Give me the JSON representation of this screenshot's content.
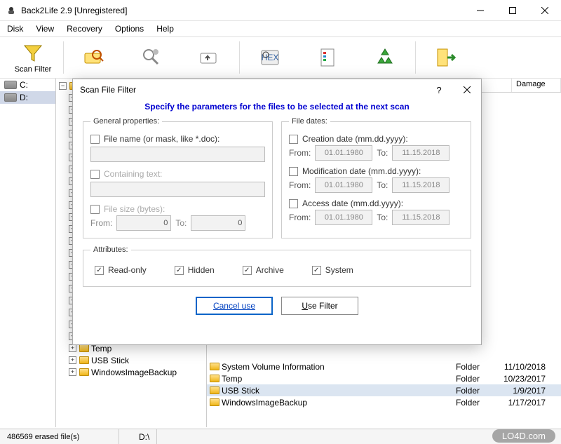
{
  "window": {
    "title": "Back2Life 2.9 [Unregistered]"
  },
  "menu": [
    "Disk",
    "View",
    "Recovery",
    "Options",
    "Help"
  ],
  "toolbar": {
    "scan_filter": "Scan Filter"
  },
  "drives": [
    "C:",
    "D:"
  ],
  "tree_items": [
    "Temp",
    "USB Stick",
    "WindowsImageBackup"
  ],
  "list": {
    "headers": {
      "damage": "Damage"
    },
    "rows": [
      {
        "name": "System Volume Information",
        "type": "Folder",
        "date": "11/10/2018"
      },
      {
        "name": "Temp",
        "type": "Folder",
        "date": "10/23/2017"
      },
      {
        "name": "USB Stick",
        "type": "Folder",
        "date": "1/9/2017"
      },
      {
        "name": "WindowsImageBackup",
        "type": "Folder",
        "date": "1/17/2017"
      }
    ]
  },
  "status": {
    "erased": "486569  erased file(s)",
    "path": "D:\\"
  },
  "watermark": "LO4D.com",
  "dialog": {
    "title": "Scan File Filter",
    "heading": "Specify the parameters for the files to be selected at the next scan",
    "general": {
      "legend": "General properties:",
      "filename_label": "File name (or mask, like *.doc):",
      "filename_value": "",
      "containing_label": "Containing text:",
      "containing_value": "",
      "filesize_label": "File size (bytes):",
      "from_label": "From:",
      "to_label": "To:",
      "size_from": "0",
      "size_to": "0"
    },
    "dates": {
      "legend": "File dates:",
      "creation_label": "Creation date (mm.dd.yyyy):",
      "modification_label": "Modification date (mm.dd.yyyy):",
      "access_label": "Access date (mm.dd.yyyy):",
      "from_label": "From:",
      "to_label": "To:",
      "default_from": "01.01.1980",
      "default_to": "11.15.2018"
    },
    "attributes": {
      "legend": "Attributes:",
      "readonly": "Read-only",
      "hidden": "Hidden",
      "archive": "Archive",
      "system": "System"
    },
    "buttons": {
      "cancel": "Cancel use",
      "use": "Use Filter"
    }
  }
}
